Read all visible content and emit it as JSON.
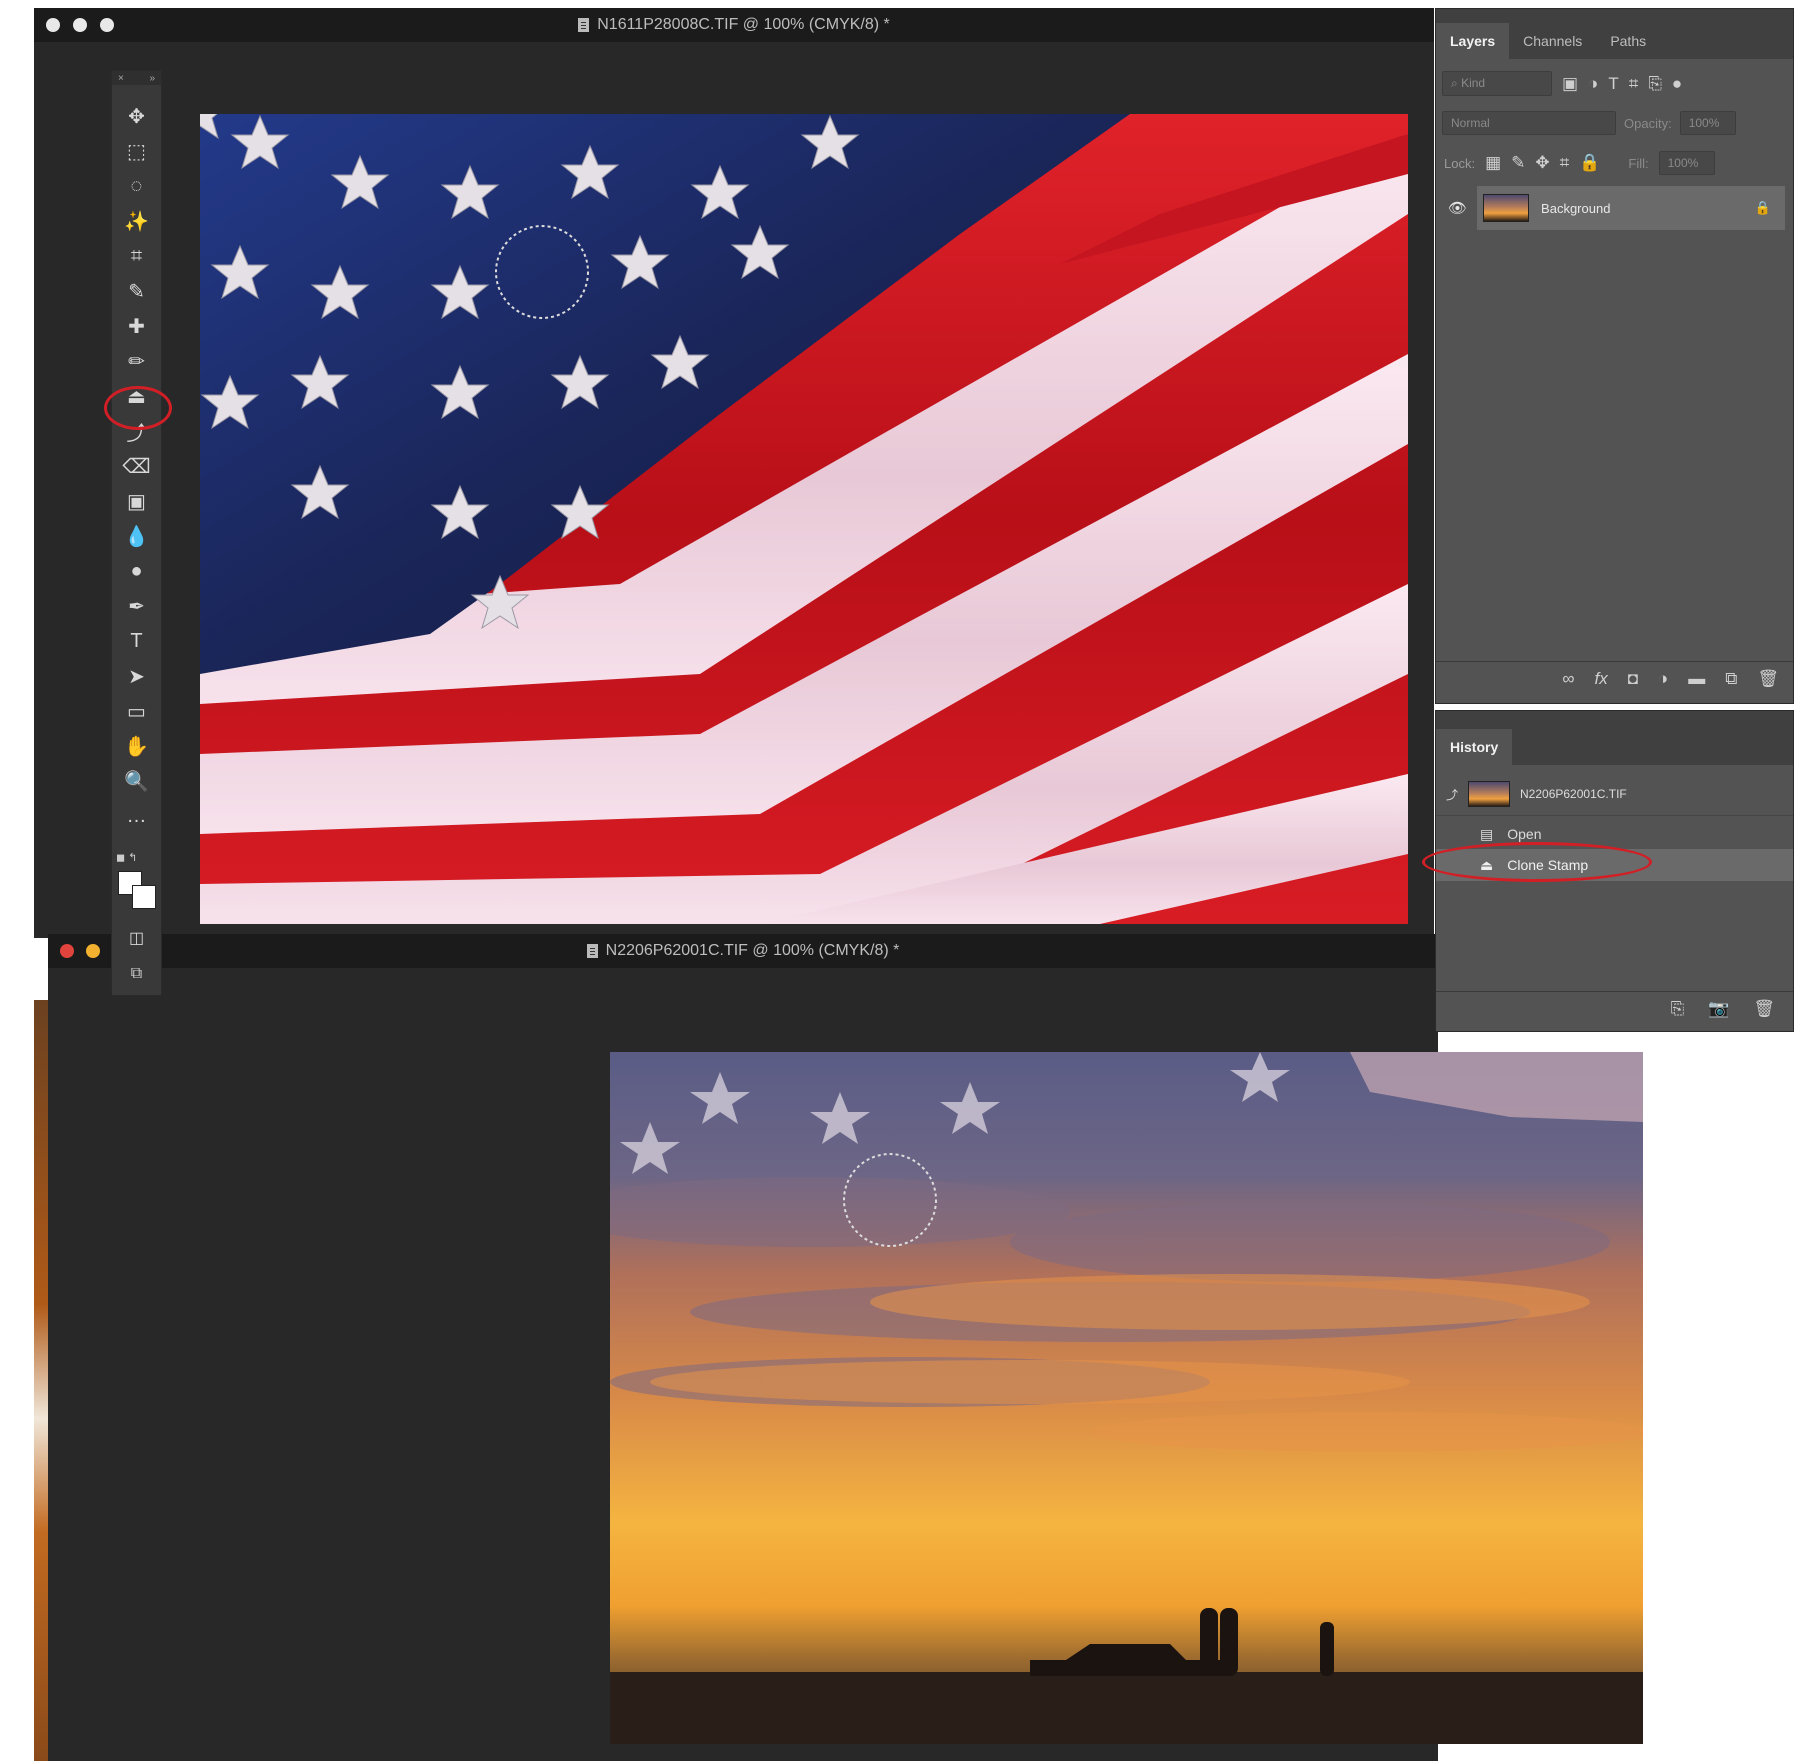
{
  "window_top": {
    "title": "N1611P28008C.TIF @ 100% (CMYK/8) *"
  },
  "window_bottom": {
    "title": "N2206P62001C.TIF @ 100% (CMYK/8) *"
  },
  "toolbar": {
    "tools": [
      {
        "name": "move-tool-icon",
        "glyph": "✥"
      },
      {
        "name": "marquee-tool-icon",
        "glyph": "⬚"
      },
      {
        "name": "lasso-tool-icon",
        "glyph": "◌"
      },
      {
        "name": "magic-wand-tool-icon",
        "glyph": "✨"
      },
      {
        "name": "crop-tool-icon",
        "glyph": "⌗"
      },
      {
        "name": "eyedropper-tool-icon",
        "glyph": "✎"
      },
      {
        "name": "healing-brush-tool-icon",
        "glyph": "✚"
      },
      {
        "name": "brush-tool-icon",
        "glyph": "✏"
      },
      {
        "name": "clone-stamp-tool-icon",
        "glyph": "⏏"
      },
      {
        "name": "history-brush-tool-icon",
        "glyph": "⤴"
      },
      {
        "name": "eraser-tool-icon",
        "glyph": "⌫"
      },
      {
        "name": "gradient-tool-icon",
        "glyph": "▣"
      },
      {
        "name": "blur-tool-icon",
        "glyph": "💧"
      },
      {
        "name": "dodge-tool-icon",
        "glyph": "●"
      },
      {
        "name": "pen-tool-icon",
        "glyph": "✒"
      },
      {
        "name": "type-tool-icon",
        "glyph": "T"
      },
      {
        "name": "path-selection-tool-icon",
        "glyph": "➤"
      },
      {
        "name": "rectangle-tool-icon",
        "glyph": "▭"
      },
      {
        "name": "hand-tool-icon",
        "glyph": "✋"
      },
      {
        "name": "zoom-tool-icon",
        "glyph": "🔍"
      },
      {
        "name": "more-tools-icon",
        "glyph": "…"
      }
    ]
  },
  "layers_panel": {
    "tabs": [
      "Layers",
      "Channels",
      "Paths"
    ],
    "filter_placeholder": "Kind",
    "blend_mode": "Normal",
    "opacity_label": "Opacity:",
    "opacity_value": "100%",
    "lock_label": "Lock:",
    "fill_label": "Fill:",
    "fill_value": "100%",
    "layers": [
      {
        "name": "Background",
        "locked": true,
        "visible": true
      }
    ]
  },
  "history_panel": {
    "tab": "History",
    "snapshot": "N2206P62001C.TIF",
    "steps": [
      {
        "label": "Open",
        "icon": "document-icon"
      },
      {
        "label": "Clone Stamp",
        "icon": "clone-stamp-icon"
      }
    ]
  },
  "colors": {
    "highlight_red": "#d21f26",
    "workspace": "#282828",
    "panel": "#535353"
  }
}
